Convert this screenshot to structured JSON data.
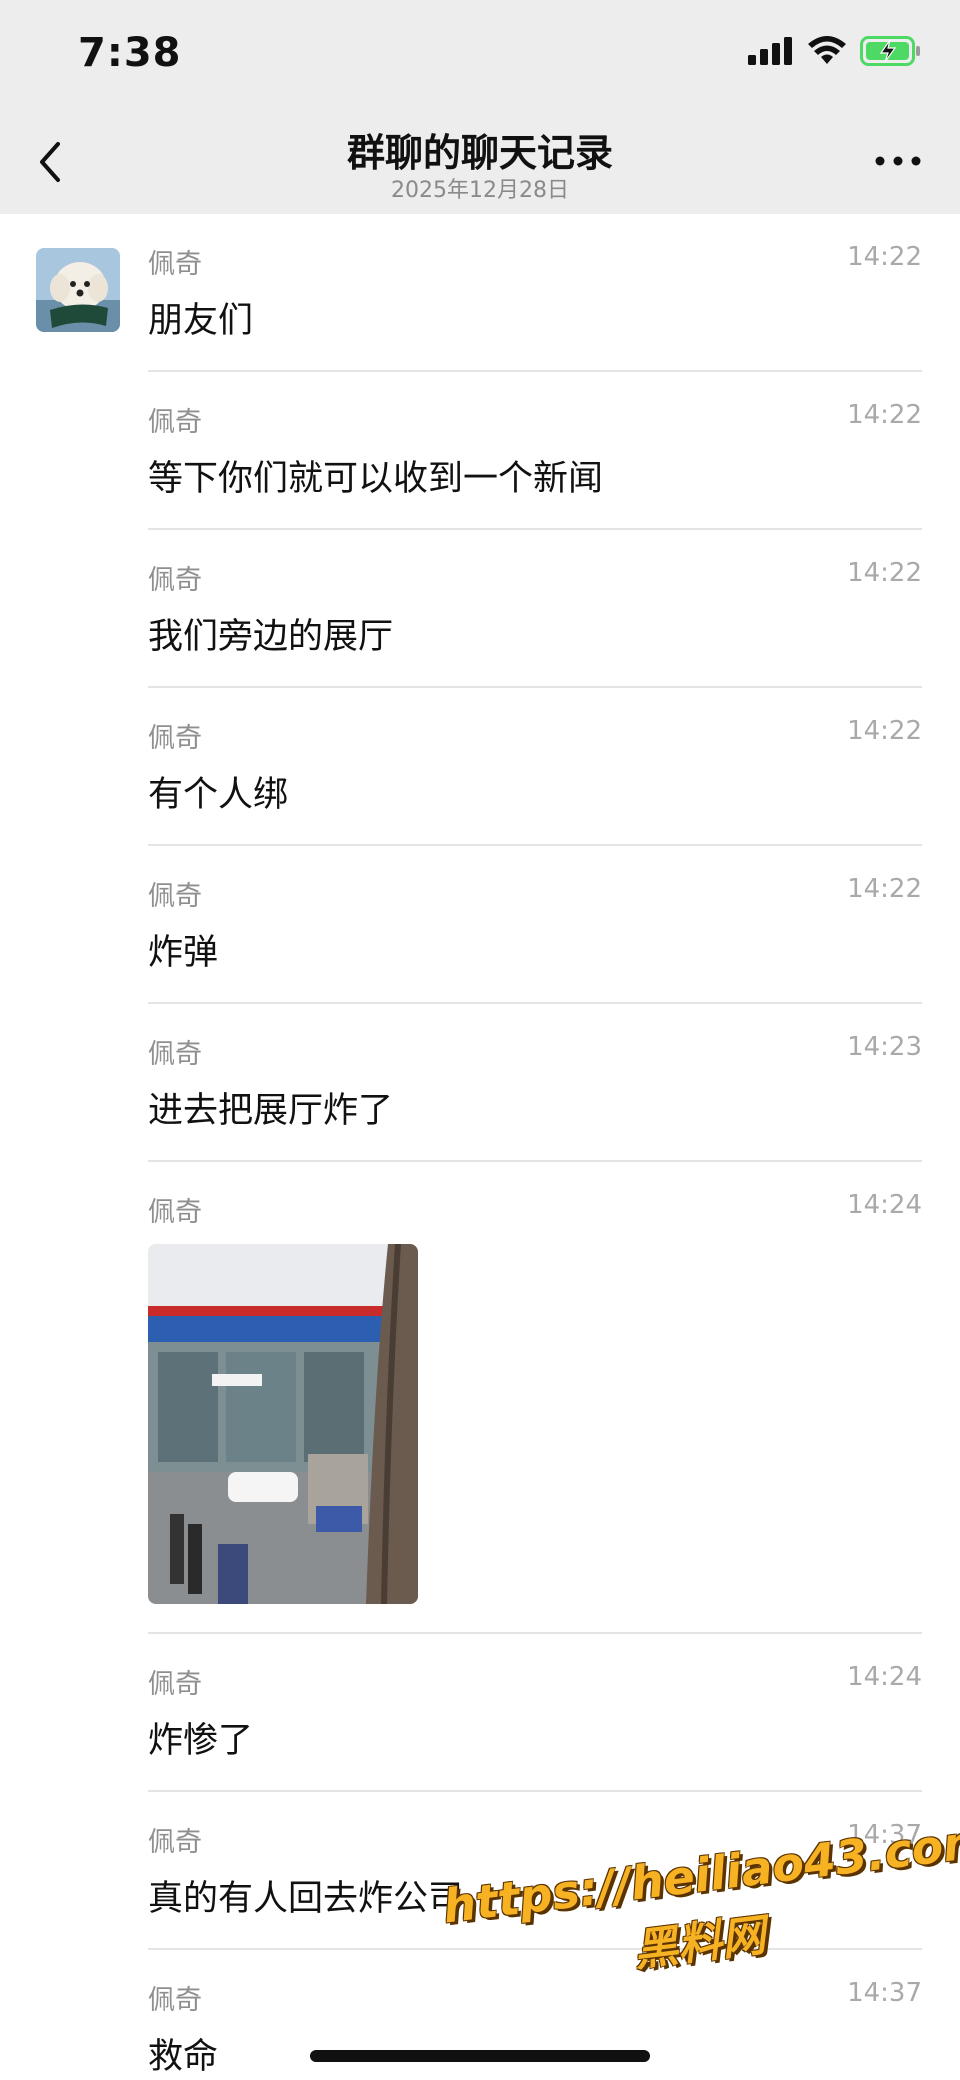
{
  "status_bar": {
    "time": "7:38"
  },
  "nav": {
    "title": "群聊的聊天记录",
    "subtitle": "2025年12月28日"
  },
  "messages": [
    {
      "sender": "佩奇",
      "time": "14:22",
      "text": "朋友们"
    },
    {
      "sender": "佩奇",
      "time": "14:22",
      "text": "等下你们就可以收到一个新闻"
    },
    {
      "sender": "佩奇",
      "time": "14:22",
      "text": "我们旁边的展厅"
    },
    {
      "sender": "佩奇",
      "time": "14:22",
      "text": "有个人绑"
    },
    {
      "sender": "佩奇",
      "time": "14:22",
      "text": "炸弹"
    },
    {
      "sender": "佩奇",
      "time": "14:23",
      "text": "进去把展厅炸了"
    },
    {
      "sender": "佩奇",
      "time": "14:24",
      "image": "photo of building storefront with shattered glass"
    },
    {
      "sender": "佩奇",
      "time": "14:24",
      "text": "炸惨了"
    },
    {
      "sender": "佩奇",
      "time": "14:37",
      "text": "真的有人回去炸公司"
    },
    {
      "sender": "佩奇",
      "time": "14:37",
      "text": "救命"
    }
  ],
  "watermark": {
    "url": "https://heiliao43.com",
    "label": "黑料网"
  },
  "colors": {
    "header_bg": "#ededed",
    "divider": "#e4e4e4",
    "secondary_text": "#8f8f8f",
    "battery_green": "#4cd964"
  }
}
